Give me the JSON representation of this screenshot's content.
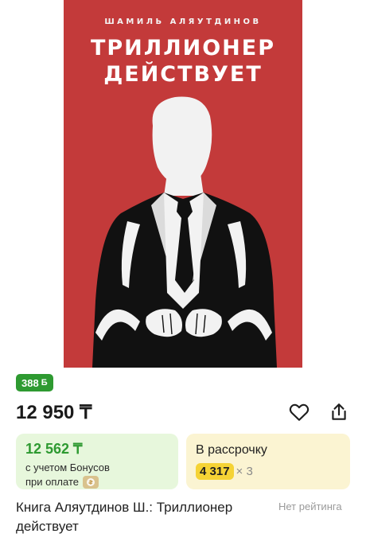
{
  "cover": {
    "author": "ШАМИЛЬ АЛЯУТДИНОВ",
    "title_line1": "ТРИЛЛИОНЕР",
    "title_line2": "ДЕЙСТВУЕТ",
    "background_color": "#c33a3a"
  },
  "bonus_badge": {
    "value": "388",
    "symbol": "Б",
    "color": "#2e9a31"
  },
  "price": "12 950 ₸",
  "actions": {
    "favorite_icon": "heart-icon",
    "share_icon": "share-icon"
  },
  "bonus_box": {
    "price": "12 562 ₸",
    "note_line1": "с учетом Бонусов",
    "note_line2": "при оплате",
    "icon": "payment-coin-icon"
  },
  "installment": {
    "label": "В рассрочку",
    "amount": "4 317",
    "multiplier": "× 3"
  },
  "product": {
    "title": "Книга Аляутдинов Ш.: Триллионер действует",
    "rating_text": "Нет рейтинга"
  }
}
